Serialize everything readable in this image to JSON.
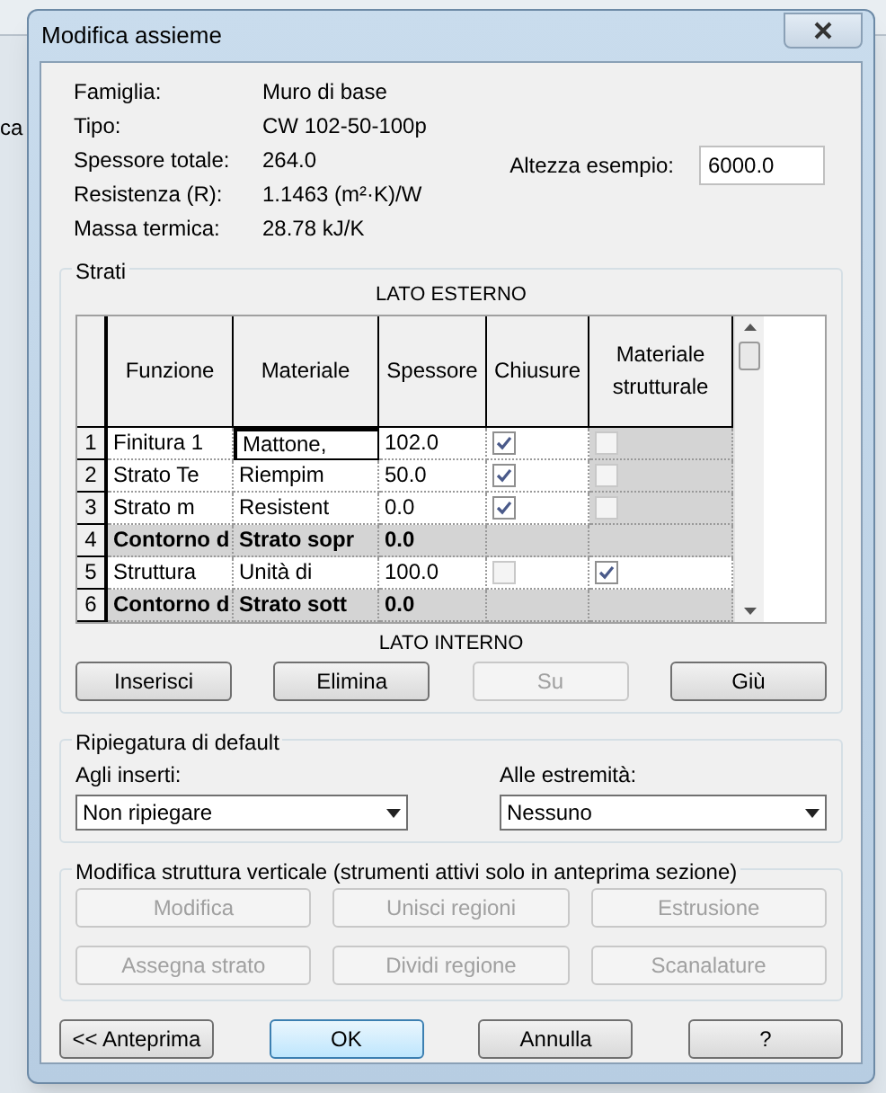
{
  "background": {
    "side_text": "ca"
  },
  "window": {
    "title": "Modifica assieme"
  },
  "info": [
    {
      "label": "Famiglia:",
      "value": "Muro di base"
    },
    {
      "label": "Tipo:",
      "value": "CW 102-50-100p"
    },
    {
      "label": "Spessore totale:",
      "value": "264.0"
    },
    {
      "label": "Resistenza (R):",
      "value": "1.1463 (m²·K)/W"
    },
    {
      "label": "Massa termica:",
      "value": "28.78 kJ/K"
    }
  ],
  "sample_height": {
    "label": "Altezza esempio:",
    "value": "6000.0"
  },
  "layers": {
    "title": "Strati",
    "top_caption": "LATO ESTERNO",
    "bottom_caption": "LATO INTERNO",
    "columns": [
      "Funzione",
      "Materiale",
      "Spessore",
      "Chiusure",
      "Materiale strutturale"
    ],
    "rows": [
      {
        "kind": "layer",
        "number": "1",
        "function": "Finitura 1",
        "material": "Mattone,",
        "material_focused": true,
        "thickness": "102.0",
        "wraps": {
          "checked": true,
          "disabled": false
        },
        "structural": {
          "checked": false,
          "disabled": true
        }
      },
      {
        "kind": "layer",
        "number": "2",
        "function": "Strato Te",
        "material": "Riempim",
        "material_focused": false,
        "thickness": "50.0",
        "wraps": {
          "checked": true,
          "disabled": false
        },
        "structural": {
          "checked": false,
          "disabled": true
        }
      },
      {
        "kind": "layer",
        "number": "3",
        "function": "Strato m",
        "material": "Resistent",
        "material_focused": false,
        "thickness": "0.0",
        "wraps": {
          "checked": true,
          "disabled": false
        },
        "structural": {
          "checked": false,
          "disabled": true
        }
      },
      {
        "kind": "boundary",
        "number": "4",
        "function": "Contorno d",
        "material": "Strato sopr",
        "material_focused": false,
        "thickness": "0.0"
      },
      {
        "kind": "layer",
        "number": "5",
        "function": "Struttura",
        "material": "Unità di",
        "material_focused": false,
        "thickness": "100.0",
        "wraps": {
          "checked": false,
          "disabled": true
        },
        "structural": {
          "checked": true,
          "disabled": false
        }
      },
      {
        "kind": "boundary",
        "number": "6",
        "function": "Contorno d",
        "material": "Strato sott",
        "material_focused": false,
        "thickness": "0.0"
      }
    ],
    "buttons": [
      {
        "label": "Inserisci",
        "disabled": false
      },
      {
        "label": "Elimina",
        "disabled": false
      },
      {
        "label": "Su",
        "disabled": true
      },
      {
        "label": "Giù",
        "disabled": false
      }
    ]
  },
  "wrapping": {
    "title": "Ripiegatura di default",
    "fields": [
      {
        "label": "Agli inserti:",
        "value": "Non ripiegare"
      },
      {
        "label": "Alle estremità:",
        "value": "Nessuno"
      }
    ]
  },
  "vertical": {
    "title": "Modifica struttura verticale (strumenti attivi solo in anteprima sezione)",
    "buttons": [
      {
        "label": "Modifica",
        "disabled": true
      },
      {
        "label": "Unisci regioni",
        "disabled": true
      },
      {
        "label": "Estrusione",
        "disabled": true
      },
      {
        "label": "Assegna strato",
        "disabled": true
      },
      {
        "label": "Dividi regione",
        "disabled": true
      },
      {
        "label": "Scanalature",
        "disabled": true
      }
    ]
  },
  "footer": [
    {
      "label": "<< Anteprima",
      "default": false
    },
    {
      "label": "OK",
      "default": true
    },
    {
      "label": "Annulla",
      "default": false
    },
    {
      "label": "?",
      "default": false
    }
  ]
}
